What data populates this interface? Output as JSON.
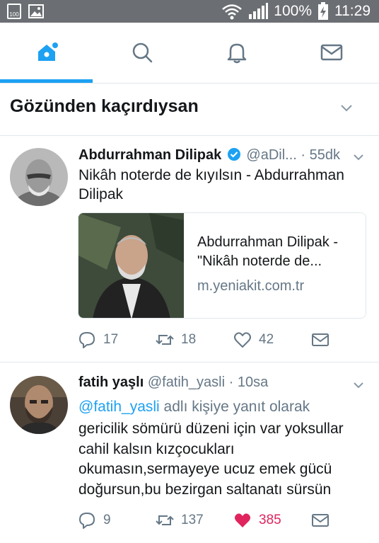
{
  "status_bar": {
    "left_badge": "100",
    "battery": "100%",
    "time": "11:29"
  },
  "nav": {
    "tabs": [
      {
        "icon": "home-icon",
        "active": true
      },
      {
        "icon": "search-icon",
        "active": false
      },
      {
        "icon": "bell-icon",
        "active": false
      },
      {
        "icon": "mail-icon",
        "active": false
      }
    ],
    "accent": "#1da1f2"
  },
  "section": {
    "title": "Gözünden kaçırdıysan"
  },
  "tweets": [
    {
      "name": "Abdurrahman Dilipak",
      "verified": true,
      "handle": "@aDil...",
      "time": "· 55dk",
      "text": "Nikâh noterde de kıyılsın - Abdurrahman Dilipak",
      "card": {
        "title": "Abdurrahman Dilipak - \"Nikâh noterde de...",
        "url": "m.yeniakit.com.tr"
      },
      "actions": {
        "replies": "17",
        "retweets": "18",
        "likes": "42",
        "liked": false
      }
    },
    {
      "name": "fatih yaşlı",
      "verified": false,
      "handle": "@fatih_yasli",
      "time": "· 10sa",
      "reply_mention": "@fatih_yasli",
      "reply_suffix": "adlı kişiye yanıt olarak",
      "text": "gericilik sömürü düzeni için var yoksullar cahil kalsın kızçocukları okumasın,sermayeye ucuz emek gücü doğursun,bu bezirgan saltanatı sürsün",
      "actions": {
        "replies": "9",
        "retweets": "137",
        "likes": "385",
        "liked": true
      }
    }
  ],
  "colors": {
    "like_active": "#e0245e",
    "muted": "#657786",
    "divider": "#e1e8ed"
  }
}
